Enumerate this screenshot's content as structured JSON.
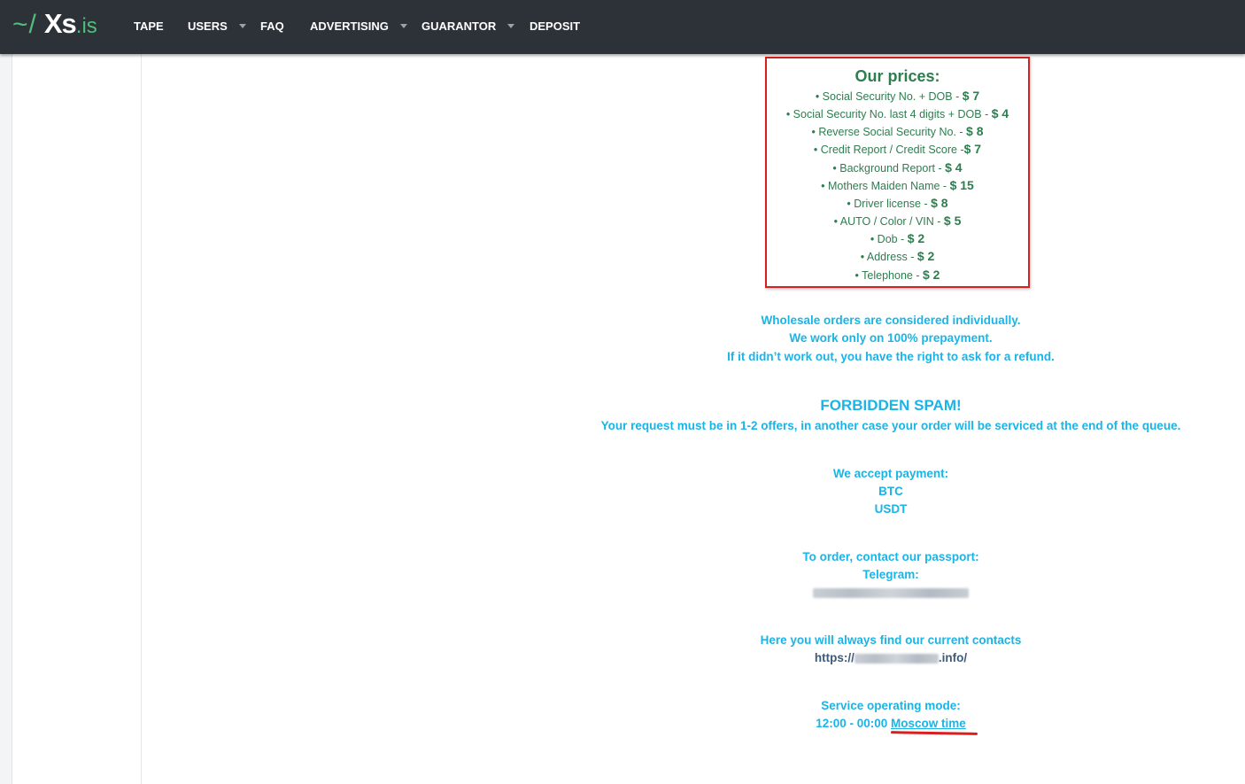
{
  "logo": {
    "tilde": "~/",
    "name": "Xs",
    "tld": ".is"
  },
  "nav": {
    "tape": "TAPE",
    "users": "USERS",
    "faq": "FAQ",
    "advertising": "ADVERTISING",
    "guarantor": "GUARANTOR",
    "deposit": "DEPOSIT"
  },
  "prices": {
    "title": "Our prices:",
    "items": [
      {
        "label": "• Social Security No. + DOB - ",
        "amount": "$ 7"
      },
      {
        "label": "• Social Security No. last 4 digits + DOB - ",
        "amount": "$ 4"
      },
      {
        "label": "• Reverse Social Security No. - ",
        "amount": "$ 8"
      },
      {
        "label": "• Credit Report / Credit Score -",
        "amount": "$ 7"
      },
      {
        "label": "• Background Report - ",
        "amount": "$ 4"
      },
      {
        "label": "• Mothers Maiden Name - ",
        "amount": "$ 15"
      },
      {
        "label": "• Driver license - ",
        "amount": "$ 8"
      },
      {
        "label": "• AUTO / Color / VIN - ",
        "amount": "$ 5"
      },
      {
        "label": "• Dob - ",
        "amount": "$ 2"
      },
      {
        "label": "• Address - ",
        "amount": "$ 2"
      },
      {
        "label": "• Telephone - ",
        "amount": "$ 2"
      }
    ]
  },
  "terms": {
    "line1": "Wholesale orders are considered individually.",
    "line2": "We work only on 100% prepayment.",
    "line3": "If it didn’t work out, you have the right to ask for a refund."
  },
  "spam": {
    "title": "FORBIDDEN SPAM!",
    "text": "Your request must be in 1-2 offers, in another case your order will be serviced at the end of the queue."
  },
  "payment": {
    "title": "We accept payment:",
    "method1": "BTC",
    "method2": "USDT"
  },
  "order": {
    "title": "To order, contact our passport:",
    "telegram": "Telegram:"
  },
  "contacts": {
    "title": "Here you will always find our current contacts",
    "url_prefix": "https://",
    "url_suffix": ".info/"
  },
  "hours": {
    "title": "Service operating mode:",
    "time": "12:00 - 00:00 ",
    "zone": "Moscow time"
  },
  "colors": {
    "nav_bg": "#2d3138",
    "brand_green": "#4fbf7b",
    "price_green": "#2e7d4f",
    "info_blue": "#1ab4e6",
    "highlight_red": "#d9201f"
  }
}
